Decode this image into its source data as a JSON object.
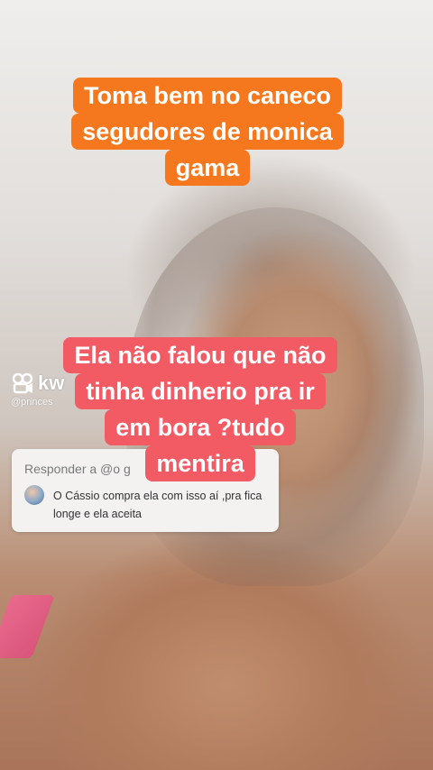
{
  "video": {
    "captions": {
      "top": {
        "lines": [
          "Toma  bem no caneco",
          "segudores de monica",
          "gama"
        ],
        "color": "#f6781e"
      },
      "middle": {
        "lines": [
          "Ela  não falou que não",
          "tinha dinherio pra ir",
          "em bora ?tudo",
          "mentira"
        ],
        "color": "#f25a64"
      }
    },
    "watermark": {
      "logo": "kw",
      "handle": "@princes"
    }
  },
  "reply_card": {
    "title": "Responder a @o g",
    "comment": "O Cássio compra ela com isso aí ,pra fica longe e ela aceita"
  }
}
